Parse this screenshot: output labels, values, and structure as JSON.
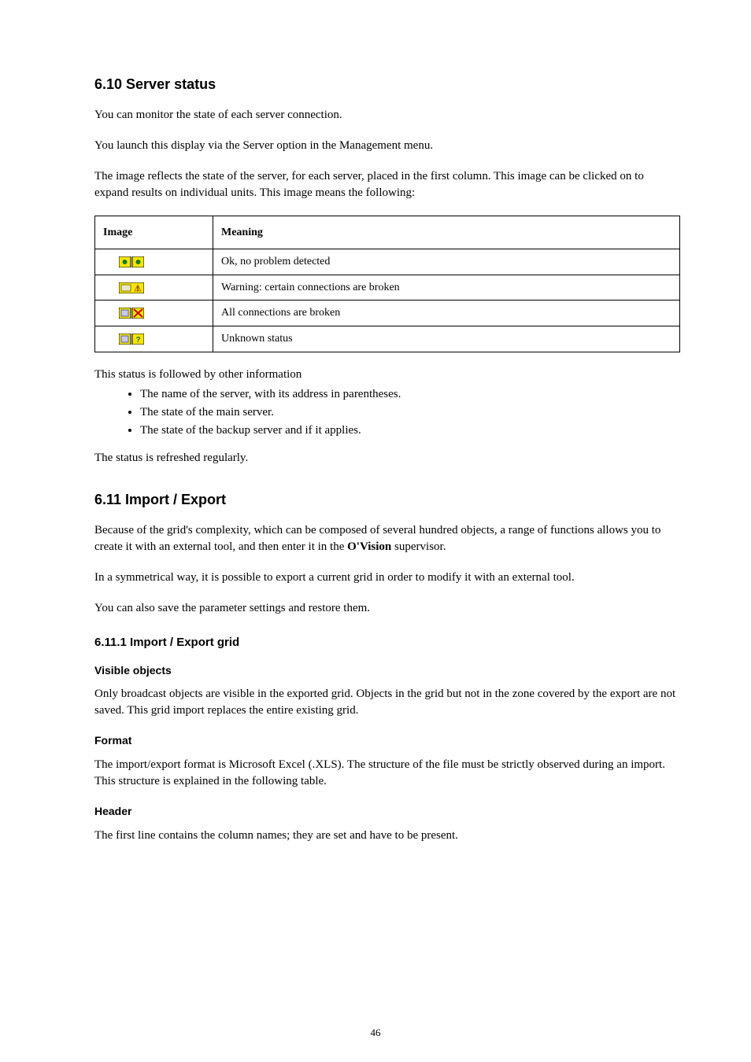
{
  "sections": {
    "serverStatus": {
      "title": "6.10 Server status",
      "para1": "You can monitor the state of each server connection.",
      "para2": "You launch this display via the Server option in the Management menu.",
      "para3_pre": "The image reflects the state of the server, for each server, placed in the first column. This image can be clicked on to expand results on individual units. This image means the following:",
      "table": {
        "headers": [
          "Image",
          "Meaning"
        ],
        "rows": [
          {
            "icon": "ok-pair-icon",
            "meaning": "Ok, no problem detected"
          },
          {
            "icon": "warn-icon",
            "meaning": "Warning: certain connections are broken"
          },
          {
            "icon": "fail-icon",
            "meaning": "All connections are broken"
          },
          {
            "icon": "unknown-icon",
            "meaning": "Unknown status"
          }
        ]
      },
      "followup_lead": "This status is followed by other information",
      "bullets": [
        "The name of the server, with its address in parentheses.",
        "The state of the main server.",
        "The state of the backup server and if it applies."
      ],
      "tail": "The status is refreshed regularly."
    },
    "importExport": {
      "title": "6.11 Import / Export",
      "intro_part1": "Because of the grid's complexity, which can be composed of several hundred objects, a range of functions allows you to create it with an external tool, and then enter it in the ",
      "intro_product_strong": "O'Vision",
      "intro_part2": " supervisor.",
      "para_sym": "In a symmetrical way, it is possible to export a current grid in order to modify it with an external tool.",
      "para_save": "You can also save the parameter settings and restore them."
    },
    "importExportGrid": {
      "heading": "6.11.1 Import / Export grid",
      "h_visible": "Visible objects",
      "p_visible": "Only broadcast objects are visible in the exported grid. Objects in the grid but not in the zone covered by the export are not saved. This grid import replaces the entire existing grid.",
      "h_format": "Format",
      "p_format": "The import/export format is Microsoft Excel (.XLS). The structure of the file must be strictly observed during an import. This structure is explained in the following table.",
      "h_header": "Header",
      "p_header": "The first line contains the column names; they are set and have to be present."
    }
  },
  "icon_alts": {
    "ok-pair-icon": "two green-dot status tiles",
    "warn-icon": "warning tile with exclamation",
    "fail-icon": "tile pair with red X",
    "unknown-icon": "tile pair with question mark"
  },
  "page_number": "46"
}
